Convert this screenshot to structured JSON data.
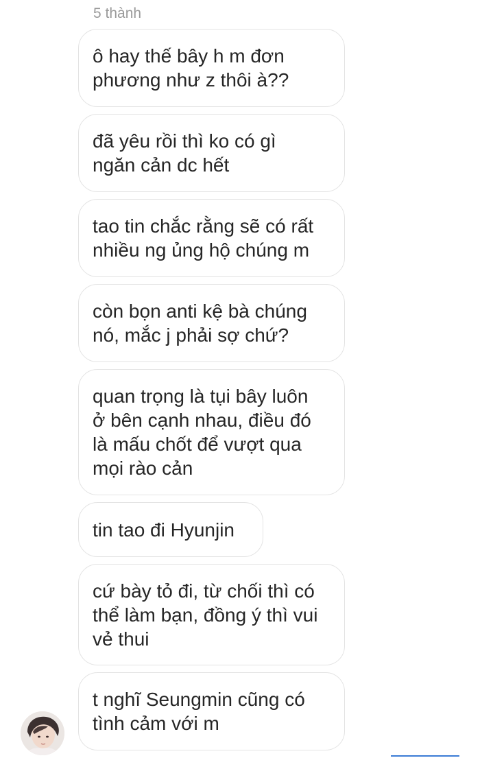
{
  "sender_name": "5 thành",
  "messages": [
    {
      "text": "ô hay thế bây h m đơn\nphương như z thôi à??"
    },
    {
      "text": "đã yêu rồi thì ko có gì\nngăn cản dc hết"
    },
    {
      "text": "tao tin chắc rằng sẽ có rất\nnhiều ng ủng hộ chúng m"
    },
    {
      "text": "còn bọn anti kệ bà chúng\nnó, mắc j phải sợ chứ?"
    },
    {
      "text": "quan trọng là tụi bây luôn\nở bên cạnh nhau, điều đó\nlà mấu chốt để vượt qua\nmọi rào cản"
    },
    {
      "text": "tin tao đi Hyunjin"
    },
    {
      "text": "cứ bày tỏ đi, từ chối thì có\nthể làm bạn, đồng ý thì vui\nvẻ thui"
    },
    {
      "text": "t nghĩ Seungmin cũng có\ntình cảm với m"
    }
  ],
  "colors": {
    "bubble_border": "#e3e3e3",
    "text": "#262626",
    "sender_name": "#9a9a9a",
    "accent": "#3a7bd5"
  }
}
